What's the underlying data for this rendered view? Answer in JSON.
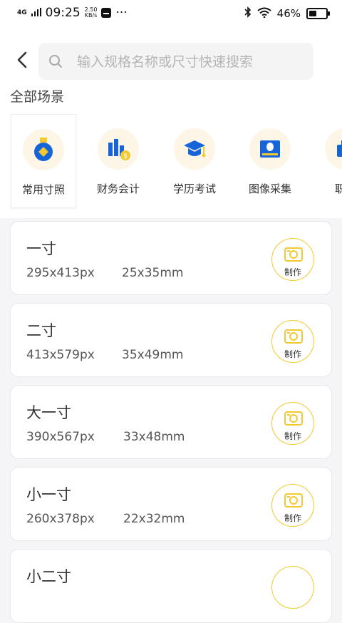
{
  "status_bar": {
    "network": "4G",
    "time": "09:25",
    "speed_value": "2.50",
    "speed_unit": "KB/s",
    "more": "···",
    "battery": "46%"
  },
  "search": {
    "placeholder": "输入规格名称或尺寸快速搜索"
  },
  "section_title": "全部场景",
  "categories": [
    {
      "label": "常用寸照",
      "icon": "medal-icon"
    },
    {
      "label": "财务会计",
      "icon": "finance-chart-icon"
    },
    {
      "label": "学历考试",
      "icon": "graduation-cap-icon"
    },
    {
      "label": "图像采集",
      "icon": "id-card-icon"
    },
    {
      "label": "职业",
      "icon": "briefcase-icon"
    }
  ],
  "specs": [
    {
      "name": "一寸",
      "px": "295x413px",
      "mm": "25x35mm",
      "action": "制作"
    },
    {
      "name": "二寸",
      "px": "413x579px",
      "mm": "35x49mm",
      "action": "制作"
    },
    {
      "name": "大一寸",
      "px": "390x567px",
      "mm": "33x48mm",
      "action": "制作"
    },
    {
      "name": "小一寸",
      "px": "260x378px",
      "mm": "22x32mm",
      "action": "制作"
    },
    {
      "name": "小二寸",
      "px": "",
      "mm": "",
      "action": ""
    }
  ],
  "colors": {
    "accent": "#f3c930",
    "blue": "#1565d8",
    "background": "#f5f5f7"
  }
}
